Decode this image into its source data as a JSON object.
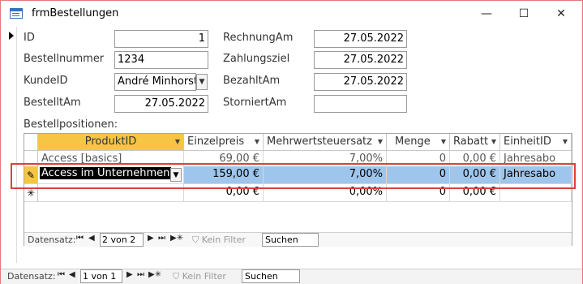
{
  "window": {
    "title": "frmBestellungen",
    "minimize": "—",
    "maximize": "☐",
    "close": "✕"
  },
  "form": {
    "id": {
      "label": "ID",
      "value": "1"
    },
    "bestellnummer": {
      "label": "Bestellnummer",
      "value": "1234"
    },
    "kundeid": {
      "label": "KundeID",
      "value": "André Minhorst"
    },
    "bestelltam": {
      "label": "BestelltAm",
      "value": "27.05.2022"
    },
    "rechnungam": {
      "label": "RechnungAm",
      "value": "27.05.2022"
    },
    "zahlungsziel": {
      "label": "Zahlungsziel",
      "value": "27.05.2022"
    },
    "bezahltam": {
      "label": "BezahltAm",
      "value": "27.05.2022"
    },
    "storniertam": {
      "label": "StorniertAm",
      "value": ""
    },
    "subform_label": "Bestellpositionen:"
  },
  "grid": {
    "columns": [
      "ProduktID",
      "Einzelpreis",
      "Mehrwertsteuersatz",
      "Menge",
      "Rabatt",
      "EinheitID"
    ],
    "rows": [
      [
        "Access [basics]",
        "69,00 €",
        "7,00%",
        "0",
        "0,00 €",
        "Jahresabo"
      ],
      [
        "Access im Unternehmen",
        "159,00 €",
        "7,00%",
        "0",
        "0,00 €",
        "Jahresabo"
      ],
      [
        "",
        "0,00 €",
        "0,00%",
        "0",
        "0,00 €",
        ""
      ]
    ],
    "new_row_marker": "✳",
    "edit_marker": "✎"
  },
  "subnav": {
    "label": "Datensatz:",
    "record": "2 von 2",
    "filter": "Kein Filter",
    "search": "Suchen"
  },
  "mainnav": {
    "label": "Datensatz:",
    "record": "1 von 1",
    "filter": "Kein Filter",
    "search": "Suchen"
  },
  "nav_buttons": {
    "first": "⏮",
    "prev": "◀",
    "next": "▶",
    "last": "⏭",
    "new": "▶✳"
  },
  "colors": {
    "active_header": "#f6c544",
    "selection": "#9ec5ec",
    "highlight_border": "#d9433b"
  }
}
